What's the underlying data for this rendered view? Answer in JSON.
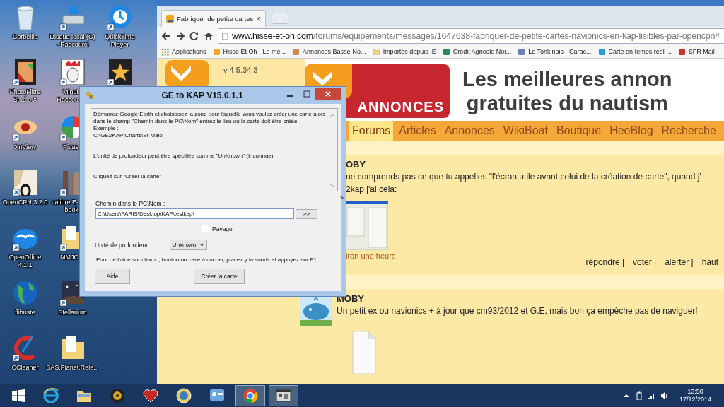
{
  "desktop": {
    "icons": [
      {
        "label": "Corbeille",
        "shortcut": false
      },
      {
        "label": "PhotoFiltre Studio X",
        "shortcut": true
      },
      {
        "label": "XnView",
        "shortcut": true
      },
      {
        "label": "OpenCPN 3.2.0",
        "shortcut": true
      },
      {
        "label": "OpenOffice 4.1.1",
        "shortcut": true
      },
      {
        "label": "flibuste",
        "shortcut": false
      },
      {
        "label": "CCleaner",
        "shortcut": true
      },
      {
        "label": "Disque local (C) - Raccourci",
        "shortcut": true
      },
      {
        "label": "Minut Raccou",
        "shortcut": true
      },
      {
        "label": "Picas",
        "shortcut": true
      },
      {
        "label": "calibre E-book",
        "shortcut": true
      },
      {
        "label": "MMJC",
        "shortcut": true
      },
      {
        "label": "Stellarium",
        "shortcut": true
      },
      {
        "label": "SAS.Planet.Rele...",
        "shortcut": false
      },
      {
        "label": "QuickTime Player",
        "shortcut": true
      },
      {
        "shortcut": true
      }
    ]
  },
  "browser": {
    "tab": {
      "title": "Fabriquer de petite cartes",
      "close": "×"
    },
    "address": {
      "domain": "www.hisse-et-oh.com",
      "path": "/forums/equipements/messages/1647638-fabriquer-de-petite-cartes-navionics-en-kap-lisibles-par-opencpn#"
    },
    "bookmarks": [
      "Applications",
      "Hisse Et Oh - Le mé...",
      "Annonces Basse-No...",
      "Importés depuis IE",
      "Crédit Agricole Nor...",
      "Le Tonkinois - Carac...",
      "Carte en temps réel ...",
      "SFR Mail"
    ],
    "page": {
      "version": "v 4.5.34.3",
      "banner": {
        "badge": "ANNONCES",
        "headline": [
          "Les meilleures annon",
          "gratuites du nautism"
        ]
      },
      "nav": [
        {
          "label": "Forums",
          "selected": true
        },
        {
          "label": "Articles",
          "selected": false
        },
        {
          "label": "Annonces",
          "selected": false
        },
        {
          "label": "WikiBoat",
          "selected": false
        },
        {
          "label": "Boutique",
          "selected": false
        },
        {
          "label": "HeoBlog",
          "selected": false
        },
        {
          "label": "Recherche",
          "selected": false
        }
      ],
      "posts": [
        {
          "author": "OBY",
          "lines": [
            "ne comprends pas ce que tu appelles \"l'écran utile avant celui de la création de carte\", quand j'",
            "2kap j'ai cela:"
          ],
          "kind": "image",
          "time": "iron une heure",
          "actions": [
            "répondre |",
            "voter |",
            "alerter |",
            "haut"
          ]
        },
        {
          "author": "MOBY",
          "avatar": true,
          "lines": [
            "Un petit ex ou navionics + à jour que cm93/2012 et G.E, mais bon ça empèche pas de naviguer!"
          ],
          "kind": "file"
        }
      ]
    }
  },
  "dialog": {
    "title": "GE to KAP V15.0.1.1",
    "instruction_groups": [
      [
        "Démarrez Google Earth et choisissez la zone pour laquelle vous voulez créer une carte alors dans le champ \"Chemin dans le PC\\Nom\" entrez le lieu ou la carte doit être créée.",
        "Exemple :",
        "C:\\GE2KAP\\Charts\\St-Malo"
      ],
      [
        "L'unité de profondeur peut être spécifiée comme \"UnKnown\" (Inconnue)"
      ],
      [
        "Cliquez sur \"Créer la carte\""
      ]
    ],
    "side_arrow": ">",
    "path_label": "Chemin dans le PC\\Nom :",
    "path_value": "C:\\Users\\PARIS\\Desktop\\KAP\\testkap\\",
    "browse_button": ">>",
    "tiling": {
      "label": "Pavage",
      "checked": false
    },
    "depth_label": "Unité de profondeur :",
    "depth_value": "Unknown",
    "help_text": "Pour de l'aide sur champ, bouton ou case à cocher, placez y la souris et appuyez sur F1",
    "buttons": [
      "Aide",
      "Créer la carte"
    ]
  },
  "taskbar": {
    "apps": [
      {
        "active": false
      },
      {
        "active": false
      },
      {
        "active": false
      },
      {
        "active": false
      },
      {
        "active": false
      },
      {
        "active": false
      },
      {
        "active": true
      },
      {
        "active": true
      }
    ],
    "time": "13:50",
    "date": "17/12/2014"
  }
}
